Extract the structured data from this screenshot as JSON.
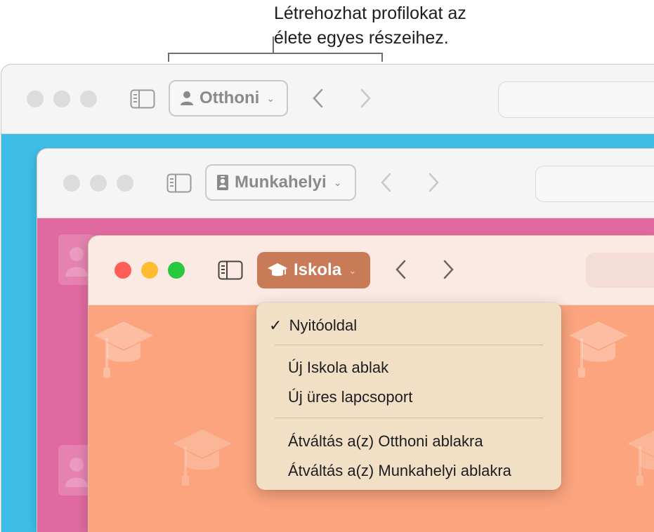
{
  "callout": {
    "line1": "Létrehozhat profilokat az",
    "line2": "élete egyes részeihez."
  },
  "windows": {
    "home": {
      "profile_label": "Otthoni",
      "profile_icon": "person-icon",
      "accent": "#3fbde6"
    },
    "work": {
      "profile_label": "Munkahelyi",
      "profile_icon": "id-badge-icon",
      "accent": "#e06aa0"
    },
    "school": {
      "profile_label": "Iskola",
      "profile_icon": "graduation-cap-icon",
      "accent": "#fba47e"
    }
  },
  "menu": {
    "checked_item": "Nyitóoldal",
    "item_new_window": "Új Iskola ablak",
    "item_new_tab_group": "Új üres lapcsoport",
    "item_switch_home": "Átváltás a(z) Otthoni ablakra",
    "item_switch_work": "Átváltás a(z) Munkahelyi ablakra"
  },
  "colors": {
    "close": "#ff5f57",
    "minimize": "#febc2e",
    "zoom": "#28c840",
    "profile_button_school": "#c97a57"
  }
}
